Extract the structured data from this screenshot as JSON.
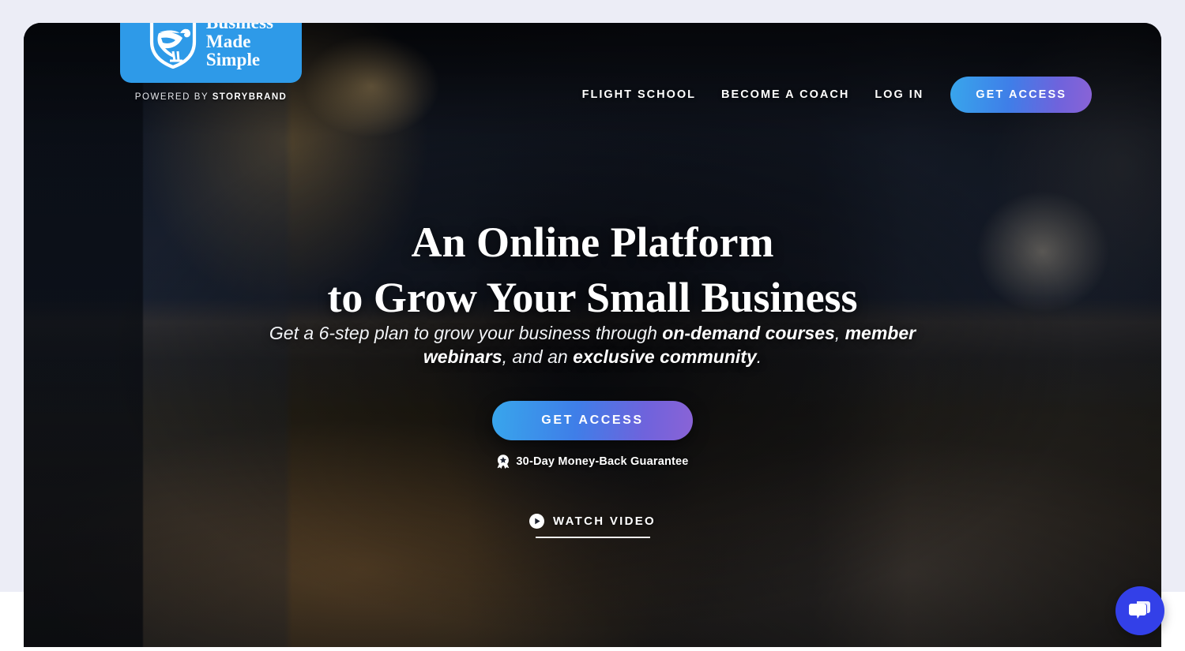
{
  "brand": {
    "logo_line1": "Business",
    "logo_line2": "Made",
    "logo_line3": "Simple",
    "logo_icon": "pelican-shield-icon",
    "logo_bg_color": "#2e9ae8",
    "powered_prefix": "POWERED BY ",
    "powered_name": "STORYBRAND"
  },
  "header": {
    "nav": [
      {
        "label": "FLIGHT SCHOOL",
        "name": "nav-link-flight-school"
      },
      {
        "label": "BECOME A COACH",
        "name": "nav-link-become-a-coach"
      },
      {
        "label": "LOG IN",
        "name": "nav-link-log-in"
      }
    ],
    "cta_label": "GET ACCESS",
    "cta_gradient_from": "#38a6ec",
    "cta_gradient_to": "#8a63d6"
  },
  "hero": {
    "headline_line1": "An Online Platform",
    "headline_line2": "to Grow Your Small Business",
    "subhead_part1": "Get a 6-step plan to grow your business through ",
    "subhead_bold1": "on-demand courses",
    "subhead_part2": ", ",
    "subhead_bold2": "member webinars",
    "subhead_part3": ", and an ",
    "subhead_bold3": "exclusive community",
    "subhead_part4": ".",
    "cta_label": "GET ACCESS",
    "guarantee_text": "30-Day Money-Back Guarantee",
    "guarantee_icon": "guarantee-badge-icon",
    "watch_video_label": "WATCH VIDEO",
    "watch_video_icon": "play-circle-icon",
    "background_description": "Man in dark shirt seated at a desk with a coffee mug in a dimly lit office"
  },
  "chat": {
    "icon": "chat-bubbles-icon",
    "color": "#3340e8"
  },
  "page": {
    "background_color": "#ecedf6",
    "section_color": "#ffffff"
  }
}
